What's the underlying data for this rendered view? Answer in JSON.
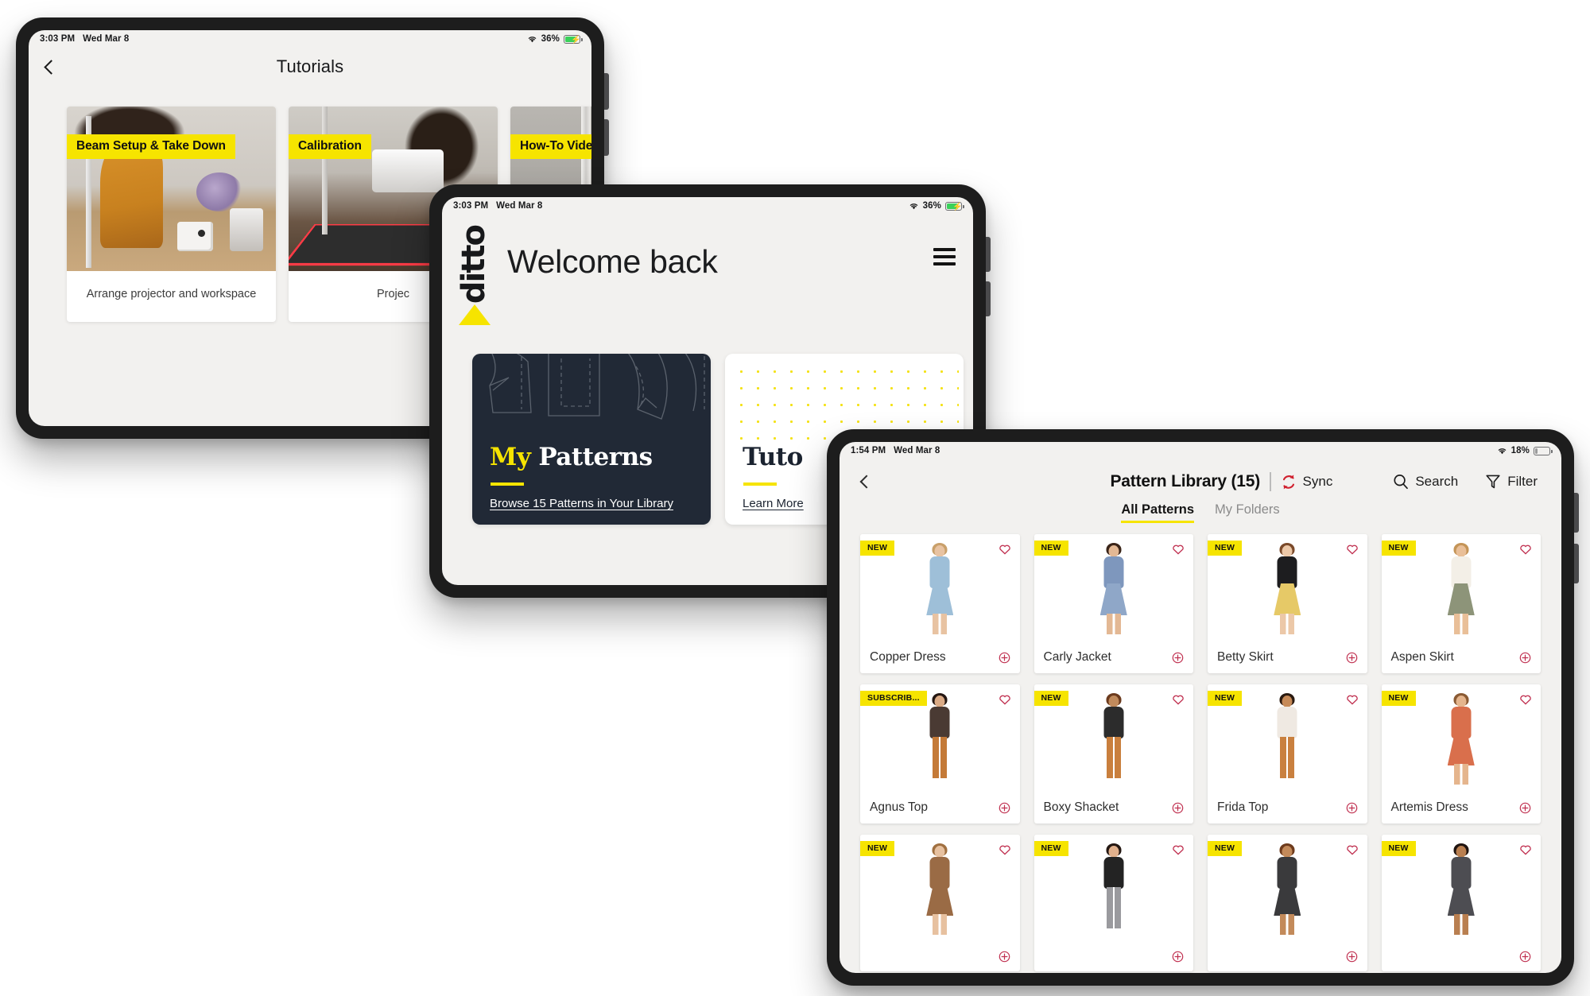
{
  "tablet_tutorials": {
    "statusbar": {
      "time": "3:03 PM",
      "date": "Wed Mar 8",
      "battery_pct": "36%",
      "wifi": "wifi-icon",
      "charging": true
    },
    "nav": {
      "back": "back-chevron",
      "title": "Tutorials"
    },
    "cards": [
      {
        "badge": "Beam Setup & Take Down",
        "caption": "Arrange projector and workspace",
        "image": "woman-setting-up-projector-beam"
      },
      {
        "badge": "Calibration",
        "caption": "Projec",
        "image": "woman-calibrating-projector-grid"
      },
      {
        "badge": "How-To Videos",
        "caption": "",
        "image": "projector-stand-closeup"
      }
    ]
  },
  "tablet_home": {
    "statusbar": {
      "time": "3:03 PM",
      "date": "Wed Mar 8",
      "battery_pct": "36%",
      "wifi": "wifi-icon",
      "charging": true
    },
    "logo": {
      "wordmark": "ditto",
      "cone": "projector-cone-icon"
    },
    "greeting": "Welcome back",
    "menu": "hamburger-menu-icon",
    "cards": [
      {
        "id": "my-patterns",
        "title_accent": "My",
        "title_rest": "Patterns",
        "link": "Browse 15 Patterns in Your Library",
        "style": "dark"
      },
      {
        "id": "tutorials",
        "title_accent": "",
        "title_rest": "Tuto",
        "link": "Learn More",
        "style": "light-dots"
      },
      {
        "id": "grid-card",
        "title_accent": "",
        "title_rest": "",
        "link": "",
        "style": "yellow-grid"
      }
    ]
  },
  "tablet_library": {
    "statusbar": {
      "time": "1:54 PM",
      "date": "Wed Mar 8",
      "battery_pct": "18%",
      "wifi": "wifi-icon",
      "charging": false
    },
    "nav": {
      "back": "back-chevron",
      "title": "Pattern Library (15)",
      "sync": {
        "label": "Sync",
        "icon": "sync-refresh-icon",
        "color": "#d0202e"
      },
      "search": {
        "label": "Search",
        "icon": "search-icon"
      },
      "filter": {
        "label": "Filter",
        "icon": "funnel-filter-icon"
      }
    },
    "tabs": [
      {
        "label": "All Patterns",
        "active": true
      },
      {
        "label": "My Folders",
        "active": false
      }
    ],
    "accent_color": "#f6e400",
    "heart_color": "#c03050",
    "patterns": [
      {
        "name": "Copper Dress",
        "badge": "NEW",
        "top": "#9ebfd8",
        "bottom": "#9ebfd8",
        "skin": "#e8c3a2",
        "hair": "#c9a06a",
        "style": "dress"
      },
      {
        "name": "Carly Jacket",
        "badge": "NEW",
        "top": "#7e97bd",
        "bottom": "#8fa7c8",
        "skin": "#e3b894",
        "hair": "#3a2418",
        "style": "dress"
      },
      {
        "name": "Betty Skirt",
        "badge": "NEW",
        "top": "#1d1d1f",
        "bottom": "#e6c967",
        "skin": "#ecc8a8",
        "hair": "#7b4a2a",
        "style": "skirt"
      },
      {
        "name": "Aspen Skirt",
        "badge": "NEW",
        "top": "#f3efe7",
        "bottom": "#8d9479",
        "skin": "#e9bf98",
        "hair": "#c49457",
        "style": "skirt"
      },
      {
        "name": "Agnus Top",
        "badge": "SUBSCRIB...",
        "top": "#4a3a33",
        "bottom": "#c47a38",
        "skin": "#dbab86",
        "hair": "#241712",
        "style": "pants"
      },
      {
        "name": "Boxy Shacket",
        "badge": "NEW",
        "top": "#2c2c2c",
        "bottom": "#c97f3d",
        "skin": "#c08a5c",
        "hair": "#6b3a1d",
        "style": "pants"
      },
      {
        "name": "Frida Top",
        "badge": "NEW",
        "top": "#efe9e2",
        "bottom": "#c9803f",
        "skin": "#c68a58",
        "hair": "#2a1a10",
        "style": "pants"
      },
      {
        "name": "Artemis Dress",
        "badge": "NEW",
        "top": "#d96f4c",
        "bottom": "#d96f4c",
        "skin": "#e5b58d",
        "hair": "#8a5a33",
        "style": "dress"
      },
      {
        "name": "",
        "badge": "NEW",
        "top": "#9a6b45",
        "bottom": "#9a6b45",
        "skin": "#e7c1a0",
        "hair": "#a07040",
        "style": "dress"
      },
      {
        "name": "",
        "badge": "NEW",
        "top": "#232323",
        "bottom": "#9a9a9e",
        "skin": "#e0b08c",
        "hair": "#241712",
        "style": "pants"
      },
      {
        "name": "",
        "badge": "NEW",
        "top": "#3a3a3c",
        "bottom": "#3a3a3c",
        "skin": "#c38a5a",
        "hair": "#6e3b1c",
        "style": "dress"
      },
      {
        "name": "",
        "badge": "NEW",
        "top": "#4d4d52",
        "bottom": "#4d4d52",
        "skin": "#b97f50",
        "hair": "#1f1410",
        "style": "dress"
      }
    ]
  }
}
